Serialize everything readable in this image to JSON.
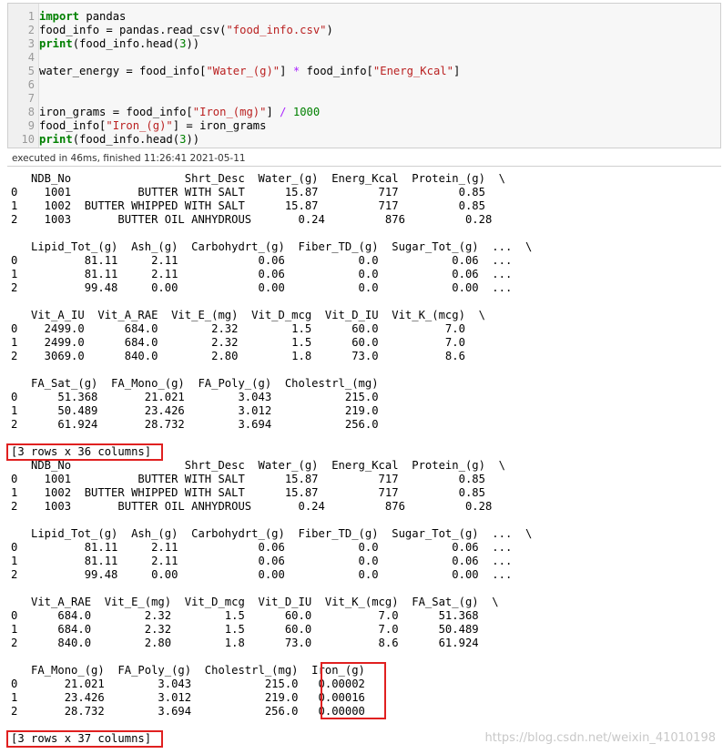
{
  "cell": {
    "line_numbers": [
      "1",
      "2",
      "3",
      "4",
      "5",
      "6",
      "7",
      "8",
      "9",
      "10"
    ],
    "lines": [
      {
        "segments": [
          {
            "text": "import",
            "cls": "kw"
          },
          {
            "text": " pandas",
            "cls": ""
          }
        ]
      },
      {
        "segments": [
          {
            "text": "food_info = pandas.read_csv(",
            "cls": ""
          },
          {
            "text": "\"food_info.csv\"",
            "cls": "str"
          },
          {
            "text": ")",
            "cls": ""
          }
        ]
      },
      {
        "segments": [
          {
            "text": "print",
            "cls": "kw"
          },
          {
            "text": "(food_info.head(",
            "cls": ""
          },
          {
            "text": "3",
            "cls": "num"
          },
          {
            "text": "))",
            "cls": ""
          }
        ]
      },
      {
        "segments": []
      },
      {
        "segments": [
          {
            "text": "water_energy = food_info[",
            "cls": ""
          },
          {
            "text": "\"Water_(g)\"",
            "cls": "str"
          },
          {
            "text": "] ",
            "cls": ""
          },
          {
            "text": "*",
            "cls": "op"
          },
          {
            "text": " food_info[",
            "cls": ""
          },
          {
            "text": "\"Energ_Kcal\"",
            "cls": "str"
          },
          {
            "text": "]",
            "cls": ""
          }
        ]
      },
      {
        "segments": []
      },
      {
        "segments": []
      },
      {
        "segments": [
          {
            "text": "iron_grams = food_info[",
            "cls": ""
          },
          {
            "text": "\"Iron_(mg)\"",
            "cls": "str"
          },
          {
            "text": "] ",
            "cls": ""
          },
          {
            "text": "/",
            "cls": "op"
          },
          {
            "text": " ",
            "cls": ""
          },
          {
            "text": "1000",
            "cls": "num"
          }
        ]
      },
      {
        "segments": [
          {
            "text": "food_info[",
            "cls": ""
          },
          {
            "text": "\"Iron_(g)\"",
            "cls": "str"
          },
          {
            "text": "] = iron_grams",
            "cls": ""
          }
        ]
      },
      {
        "segments": [
          {
            "text": "print",
            "cls": "kw"
          },
          {
            "text": "(food_info.head(",
            "cls": ""
          },
          {
            "text": "3",
            "cls": "num"
          },
          {
            "text": "))",
            "cls": ""
          }
        ]
      }
    ]
  },
  "status": "executed in 46ms, finished 11:26:41 2021-05-11",
  "output1": {
    "block1": "   NDB_No                 Shrt_Desc  Water_(g)  Energ_Kcal  Protein_(g)  \\\n0    1001          BUTTER WITH SALT      15.87         717         0.85   \n1    1002  BUTTER WHIPPED WITH SALT      15.87         717         0.85   \n2    1003       BUTTER OIL ANHYDROUS       0.24         876         0.28   ",
    "block2": "   Lipid_Tot_(g)  Ash_(g)  Carbohydrt_(g)  Fiber_TD_(g)  Sugar_Tot_(g)  ...  \\\n0          81.11     2.11            0.06           0.0           0.06  ...   \n1          81.11     2.11            0.06           0.0           0.06  ...   \n2          99.48     0.00            0.00           0.0           0.00  ...   ",
    "block3": "   Vit_A_IU  Vit_A_RAE  Vit_E_(mg)  Vit_D_mcg  Vit_D_IU  Vit_K_(mcg)  \\\n0    2499.0      684.0        2.32        1.5      60.0          7.0   \n1    2499.0      684.0        2.32        1.5      60.0          7.0   \n2    3069.0      840.0        2.80        1.8      73.0          8.6   ",
    "block4": "   FA_Sat_(g)  FA_Mono_(g)  FA_Poly_(g)  Cholestrl_(mg)  \n0      51.368       21.021        3.043           215.0  \n1      50.489       23.426        3.012           219.0  \n2      61.924       28.732        3.694           256.0  ",
    "summary": "[3 rows x 36 columns]"
  },
  "output2": {
    "block1": "   NDB_No                 Shrt_Desc  Water_(g)  Energ_Kcal  Protein_(g)  \\\n0    1001          BUTTER WITH SALT      15.87         717         0.85   \n1    1002  BUTTER WHIPPED WITH SALT      15.87         717         0.85   \n2    1003       BUTTER OIL ANHYDROUS       0.24         876         0.28   ",
    "block2": "   Lipid_Tot_(g)  Ash_(g)  Carbohydrt_(g)  Fiber_TD_(g)  Sugar_Tot_(g)  ...  \\\n0          81.11     2.11            0.06           0.0           0.06  ...   \n1          81.11     2.11            0.06           0.0           0.06  ...   \n2          99.48     0.00            0.00           0.0           0.00  ...   ",
    "block3": "   Vit_A_RAE  Vit_E_(mg)  Vit_D_mcg  Vit_D_IU  Vit_K_(mcg)  FA_Sat_(g)  \\\n0      684.0        2.32        1.5      60.0          7.0      51.368   \n1      684.0        2.32        1.5      60.0          7.0      50.489   \n2      840.0        2.80        1.8      73.0          8.6      61.924   ",
    "block4": "   FA_Mono_(g)  FA_Poly_(g)  Cholestrl_(mg)  Iron_(g)  \n0       21.021        3.043           215.0   0.00002  \n1       23.426        3.012           219.0   0.00016  \n2       28.732        3.694           256.0   0.00000  ",
    "summary": "[3 rows x 37 columns]"
  },
  "watermark": "https://blog.csdn.net/weixin_41010198",
  "colors": {
    "highlight_box": "#e02020",
    "keyword": "#008000",
    "string": "#ba2121",
    "operator": "#aa22ff"
  }
}
